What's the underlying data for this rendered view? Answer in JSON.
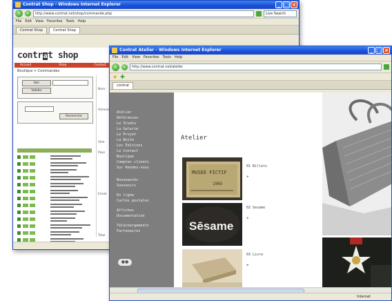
{
  "back_window": {
    "title": "Contrat Shop - Windows Internet Explorer",
    "address": "http://www.contrat.net/shop/commande.php",
    "search": "Live Search",
    "menu": [
      "File",
      "Edit",
      "View",
      "Favorites",
      "Tools",
      "Help"
    ],
    "tabs": [
      "Contrat Shop",
      "Contrat Shop"
    ],
    "logo_text": "contr",
    "logo_badge": "a",
    "logo_tail": "t shop",
    "nav": [
      "Accueil",
      "Shop",
      "Contact"
    ],
    "breadcrumb": "Boutique > Commandes",
    "buttons": [
      "Voir",
      "Valider",
      "Recherche"
    ],
    "form_labels": [
      "Nom",
      "Adresse",
      "Ville",
      "Pays",
      "Email",
      "Total"
    ]
  },
  "front_window": {
    "title": "Contrat Atelier - Windows Internet Explorer",
    "address": "http://www.contrat.net/atelier",
    "menu": [
      "File",
      "Edit",
      "View",
      "Favorites",
      "Tools",
      "Help"
    ],
    "tabs": [
      "contrat"
    ],
    "sidebar": {
      "nav": [
        "Atelier",
        "Références",
        "Le Studio",
        "La Galerie",
        "Le Projet",
        "La Boite",
        "Les Éditions",
        "Le Contact",
        "Boutique",
        "Comptes clients",
        "Sur Rendez-vous"
      ],
      "groups": [
        "Nouveautés",
        "Souvenirs",
        "En ligne",
        "Cartes postales",
        "Affiches",
        "Documentation",
        "Téléchargements",
        "Partenaires"
      ]
    },
    "heading": "Atelier",
    "items": [
      {
        "caption": "01 Billets",
        "more": "+",
        "image_text": "MUSEE FICTIF",
        "image_sub": "1965"
      },
      {
        "caption": "02 Sesame",
        "more": "+",
        "image_text": "Sēsame"
      },
      {
        "caption": "03 Livre",
        "more": "+"
      }
    ],
    "status": "Internet"
  },
  "colors": {
    "xp_blue": "#1a4fd6",
    "sidebar_gray": "#7e7e7e",
    "shop_red": "#c9442b",
    "list_green": "#7cba4f"
  }
}
